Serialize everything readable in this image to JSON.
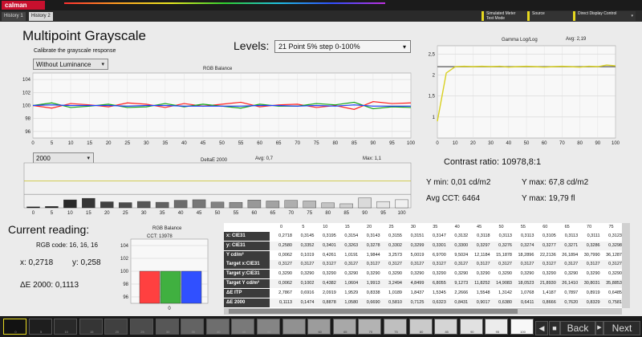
{
  "app": {
    "logo": "calman",
    "tabs": [
      "History 1",
      "History 2"
    ]
  },
  "devices": [
    {
      "label": "Simulated Meter\nTest Mode"
    },
    {
      "label": "Source"
    },
    {
      "label": "Direct Display Control"
    }
  ],
  "header": {
    "title": "Multipoint Grayscale",
    "subtitle": "Calibrate the grayscale response",
    "levels_label": "Levels:",
    "levels_value": "21 Point 5% step 0-100%",
    "luminance_select": "Without Luminance",
    "de_select": "2000"
  },
  "charts": {
    "rgb_balance_title": "RGB Balance",
    "rgb_yticks": [
      "104",
      "102",
      "100",
      "98",
      "96"
    ],
    "deltae_title": "DeltaE 2000",
    "deltae_avg": "Avg: 0,7",
    "deltae_max": "Max: 1,1",
    "xticks": [
      "0",
      "5",
      "10",
      "15",
      "20",
      "25",
      "30",
      "35",
      "40",
      "45",
      "50",
      "55",
      "60",
      "65",
      "70",
      "75",
      "80",
      "85",
      "90",
      "95",
      "100"
    ],
    "gamma_title": "Gamma Log/Log",
    "gamma_avg": "Avg: 2,19",
    "gamma_yticks": [
      "2,5",
      "2",
      "1,5",
      "1"
    ],
    "small_title": "RGB Balance",
    "small_cct": "CCT: 13978",
    "small_yticks": [
      "104",
      "102",
      "100",
      "98",
      "96"
    ],
    "small_xlabel": "0"
  },
  "chart_data": [
    {
      "type": "line",
      "title": "RGB Balance",
      "x": [
        0,
        5,
        10,
        15,
        20,
        25,
        30,
        35,
        40,
        45,
        50,
        55,
        60,
        65,
        70,
        75,
        80,
        85,
        90,
        95,
        100
      ],
      "ylim": [
        95,
        105
      ],
      "series": [
        {
          "color": "#ff2020",
          "values": [
            100.0,
            99.6,
            100.3,
            100.1,
            99.8,
            100.4,
            100.2,
            99.7,
            100.3,
            99.9,
            100.2,
            100.5,
            99.8,
            100.1,
            100.2,
            99.7,
            100.0,
            99.4,
            100.6,
            100.3,
            100.4
          ]
        },
        {
          "color": "#10a010",
          "values": [
            100.0,
            100.4,
            99.7,
            99.9,
            100.2,
            99.7,
            99.8,
            100.3,
            99.8,
            100.2,
            99.9,
            99.6,
            100.2,
            99.9,
            99.9,
            100.3,
            100.1,
            100.5,
            99.5,
            99.8,
            99.7
          ]
        },
        {
          "color": "#2040ff",
          "values": [
            100.0,
            100.1,
            100.0,
            100.0,
            100.0,
            99.9,
            100.0,
            100.0,
            99.9,
            99.9,
            99.9,
            99.9,
            100.0,
            100.0,
            99.9,
            100.0,
            99.9,
            100.1,
            99.9,
            99.9,
            99.9
          ]
        }
      ]
    },
    {
      "type": "bar",
      "title": "DeltaE 2000",
      "categories": [
        "0",
        "5",
        "10",
        "15",
        "20",
        "25",
        "30",
        "35",
        "40",
        "45",
        "50",
        "55",
        "60",
        "65",
        "70",
        "75",
        "80",
        "85",
        "90",
        "95",
        "100"
      ],
      "values": [
        0.11,
        0.15,
        0.89,
        1.06,
        0.67,
        0.58,
        0.71,
        0.62,
        0.84,
        0.9,
        0.64,
        0.61,
        0.87,
        0.76,
        0.83,
        0.76,
        0.55,
        0.45,
        1.1,
        0.7,
        0.9
      ],
      "ylim": [
        0,
        5
      ]
    },
    {
      "type": "line",
      "title": "Gamma Log/Log",
      "x": [
        0,
        5,
        10,
        15,
        20,
        25,
        30,
        35,
        40,
        45,
        50,
        55,
        60,
        65,
        70,
        75,
        80,
        85,
        90,
        95,
        100
      ],
      "ylim": [
        0.5,
        2.7
      ],
      "series": [
        {
          "color": "#d8d020",
          "values": [
            0.9,
            2.05,
            2.2,
            2.21,
            2.2,
            2.21,
            2.2,
            2.21,
            2.19,
            2.2,
            2.21,
            2.2,
            2.19,
            2.2,
            2.21,
            2.2,
            2.19,
            2.21,
            2.2,
            2.24,
            2.22
          ]
        },
        {
          "color": "#707070",
          "values": [
            2.2,
            2.2,
            2.2,
            2.2,
            2.2,
            2.2,
            2.2,
            2.2,
            2.2,
            2.2,
            2.2,
            2.2,
            2.2,
            2.2,
            2.2,
            2.2,
            2.2,
            2.2,
            2.2,
            2.2,
            2.2
          ]
        }
      ]
    },
    {
      "type": "bar",
      "title": "RGB Balance",
      "categories": [
        "R",
        "G",
        "B"
      ],
      "values": [
        100,
        100,
        100
      ],
      "ylim": [
        95,
        105
      ]
    }
  ],
  "stats": {
    "contrast": "Contrast ratio: 10978,8:1",
    "ymin": "Y min: 0,01 cd/m2",
    "ymax": "Y max: 67,8 cd/m2",
    "avgcct": "Avg CCT: 6464",
    "ymaxfl": "Y max: 19,79 fl"
  },
  "reading": {
    "title": "Current reading:",
    "rgb_code": "RGB code: 16, 16, 16",
    "x": "x: 0,2718",
    "y": "y: 0,258",
    "de": "ΔE 2000: 0,1113"
  },
  "table": {
    "columns": [
      "0",
      "5",
      "10",
      "15",
      "20",
      "25",
      "30",
      "35",
      "40",
      "45",
      "50",
      "55",
      "60",
      "65",
      "70",
      "75"
    ],
    "rows": [
      {
        "label": "x: CIE31",
        "values": [
          "0,2718",
          "0,3145",
          "0,3195",
          "0,3154",
          "0,3143",
          "0,3155",
          "0,3151",
          "0,3147",
          "0,3132",
          "0,3118",
          "0,3113",
          "0,3113",
          "0,3105",
          "0,3113",
          "0,3111",
          "0,3123"
        ]
      },
      {
        "label": "y: CIE31",
        "values": [
          "0,2580",
          "0,3352",
          "0,3401",
          "0,3263",
          "0,3278",
          "0,3302",
          "0,3299",
          "0,3301",
          "0,3300",
          "0,3297",
          "0,3276",
          "0,3274",
          "0,3277",
          "0,3271",
          "0,3286",
          "0,3298"
        ]
      },
      {
        "label": "Y cd/m²",
        "values": [
          "0,0062",
          "0,1019",
          "0,4261",
          "1,0191",
          "1,9844",
          "3,2573",
          "5,0019",
          "6,9700",
          "9,5024",
          "12,1184",
          "15,1878",
          "18,2896",
          "22,2136",
          "26,1894",
          "30,7990",
          "36,1287"
        ]
      },
      {
        "label": "Target x:CIE31",
        "values": [
          "0,3127",
          "0,3127",
          "0,3127",
          "0,3127",
          "0,3127",
          "0,3127",
          "0,3127",
          "0,3127",
          "0,3127",
          "0,3127",
          "0,3127",
          "0,3127",
          "0,3127",
          "0,3127",
          "0,3127",
          "0,3127"
        ]
      },
      {
        "label": "Target y:CIE31",
        "values": [
          "0,3290",
          "0,3290",
          "0,3290",
          "0,3290",
          "0,3290",
          "0,3290",
          "0,3290",
          "0,3290",
          "0,3290",
          "0,3290",
          "0,3290",
          "0,3290",
          "0,3290",
          "0,3290",
          "0,3290",
          "0,3290"
        ]
      },
      {
        "label": "Target Y cd/m²",
        "values": [
          "0,0062",
          "0,1002",
          "0,4382",
          "1,0604",
          "1,9913",
          "3,2494",
          "4,8499",
          "6,8055",
          "9,1273",
          "11,8252",
          "14,9083",
          "18,0523",
          "21,8930",
          "26,1410",
          "30,8031",
          "35,8853"
        ]
      },
      {
        "label": "ΔE ITP",
        "values": [
          "2,7867",
          "0,6916",
          "2,0919",
          "1,9529",
          "0,8338",
          "1,0189",
          "1,8437",
          "1,5345",
          "2,2666",
          "1,5548",
          "1,3142",
          "1,0768",
          "1,4187",
          "0,7897",
          "0,8919",
          "0,6485"
        ]
      },
      {
        "label": "ΔE 2000",
        "values": [
          "0,1113",
          "0,1474",
          "0,8878",
          "1,0580",
          "0,6690",
          "0,5810",
          "0,7125",
          "0,6323",
          "0,8431",
          "0,9017",
          "0,6380",
          "0,6411",
          "0,8666",
          "0,7620",
          "0,8329",
          "0,7581"
        ]
      }
    ]
  },
  "swatches": [
    "0",
    "5",
    "10",
    "15",
    "20",
    "25",
    "30",
    "35",
    "40",
    "45",
    "50",
    "55",
    "60",
    "65",
    "70",
    "75",
    "80",
    "85",
    "90",
    "95",
    "100"
  ],
  "nav": {
    "back": "Back",
    "next": "Next"
  }
}
